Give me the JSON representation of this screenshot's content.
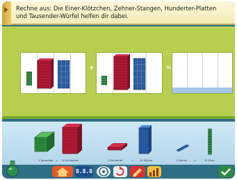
{
  "instruction": {
    "text": "Rechne aus: Die Einer-Klötzchen, Zehner-Stangen, Hunderter-Platten und Tausender-Würfel helfen dir dabei."
  },
  "equation": {
    "plus_sign": "+",
    "equals_sign": "="
  },
  "tray": {
    "labels": {
      "thousand": "1 Tausender",
      "equals_1": "=",
      "hundreds_10": "10 Hunderter",
      "hundred": "1 Hunderter",
      "equals_2": "=",
      "tens_10": "10 Zehner",
      "ten": "1 Zehner",
      "equals_3": "=",
      "ones_10": "10 Einer"
    }
  },
  "toolbar": {
    "digital_display": "8.8.8"
  },
  "colors": {
    "green_area": "#b7cf4f",
    "thousand_cube": "#2e8b3e",
    "hundred_plate": "#b01835",
    "ten_rod": "#2b5ea8",
    "one_unit": "#2e8b3e",
    "tray": "#cfe8f5",
    "frame": "#2e6f86"
  }
}
